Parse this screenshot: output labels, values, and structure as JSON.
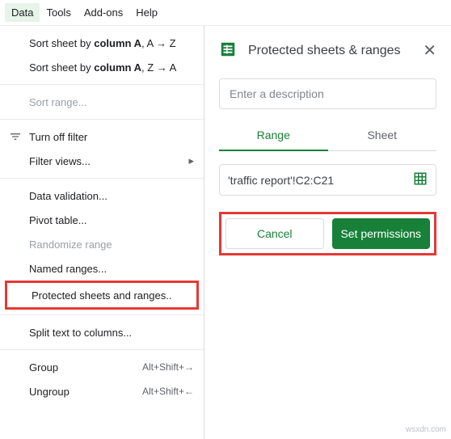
{
  "menubar": {
    "data": "Data",
    "tools": "Tools",
    "addons": "Add-ons",
    "help": "Help"
  },
  "menu": {
    "sort_az_prefix": "Sort sheet by ",
    "sort_col": "column A",
    "sort_az_suffix": ", A → Z",
    "sort_za_suffix": ", Z → A",
    "sort_range": "Sort range...",
    "turn_off_filter": "Turn off filter",
    "filter_views": "Filter views...",
    "data_validation": "Data validation...",
    "pivot_table": "Pivot table...",
    "randomize_range": "Randomize range",
    "named_ranges": "Named ranges...",
    "protected": "Protected sheets and ranges..",
    "split_text": "Split text to columns...",
    "group": "Group",
    "ungroup": "Ungroup",
    "shortcut_group": "Alt+Shift+→",
    "shortcut_ungroup": "Alt+Shift+←"
  },
  "panel": {
    "title": "Protected sheets & ranges",
    "desc_placeholder": "Enter a description",
    "tab_range": "Range",
    "tab_sheet": "Sheet",
    "range_value": "'traffic report'!C2:C21",
    "cancel": "Cancel",
    "set_permissions": "Set permissions"
  },
  "watermark": "wsxdn.com"
}
